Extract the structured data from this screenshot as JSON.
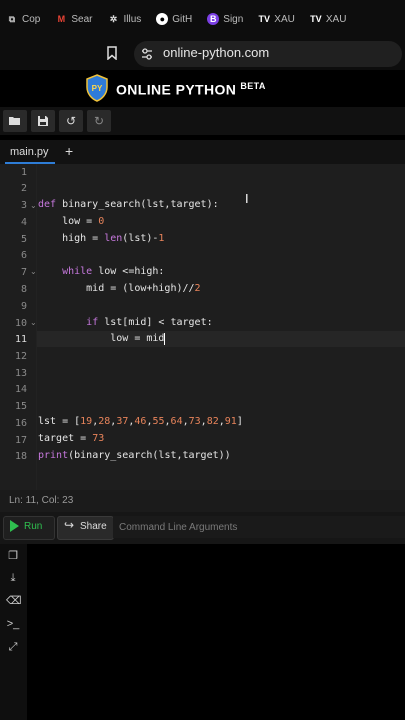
{
  "browser": {
    "tabs": [
      {
        "label": "Cop",
        "icon": "copy-icon",
        "color": "#bbbbbb"
      },
      {
        "label": "Sear",
        "icon": "gmail-icon",
        "color": "#ea4335"
      },
      {
        "label": "Illus",
        "icon": "gear-icon",
        "color": "#dddddd"
      },
      {
        "label": "GitH",
        "icon": "github-icon",
        "color": "#ffffff"
      },
      {
        "label": "Sign",
        "icon": "sign-icon",
        "color": "#7b3fe4"
      },
      {
        "label": "XAU",
        "icon": "tradingview-icon",
        "color": "#ffffff"
      },
      {
        "label": "XAU",
        "icon": "tradingview-icon",
        "color": "#ffffff"
      }
    ],
    "url": "online-python.com"
  },
  "brand": {
    "name": "ONLINE PYTHON",
    "beta": "BETA"
  },
  "toolbar": {
    "buttons": [
      "open-folder-icon",
      "save-icon",
      "undo-icon",
      "redo-icon"
    ]
  },
  "file_tabs": {
    "active": "main.py",
    "add": "+"
  },
  "editor": {
    "line_numbers": [
      "1",
      "2",
      "3",
      "4",
      "5",
      "6",
      "7",
      "8",
      "9",
      "10",
      "11",
      "12",
      "13",
      "14",
      "15",
      "16",
      "17",
      "18"
    ]
  },
  "status": {
    "text": "Ln: 11,  Col: 23"
  },
  "runbar": {
    "run_label": "Run",
    "share_label": "Share",
    "args_placeholder": "Command Line Arguments"
  },
  "colors": {
    "accent": "#2e7dd7",
    "run": "#2fbf4f",
    "keyword": "#c678dd",
    "number": "#e8845b"
  }
}
